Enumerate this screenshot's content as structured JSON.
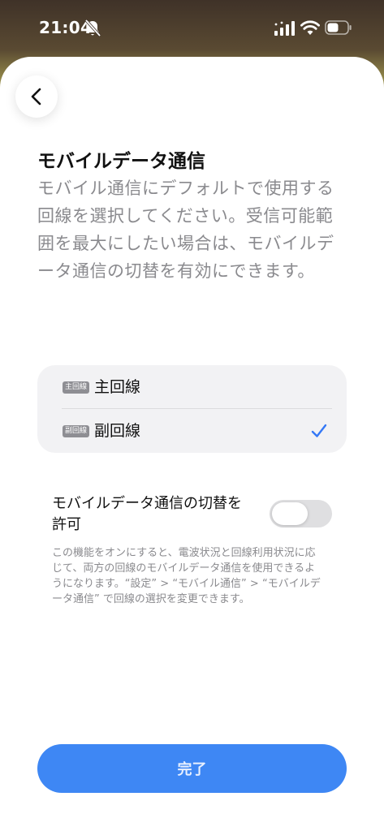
{
  "status_bar": {
    "time": "21:04",
    "icons": [
      "mute-bell-icon",
      "cellular-signal-icon",
      "wifi-icon",
      "battery-icon"
    ]
  },
  "header": {
    "back_icon": "chevron-left-icon",
    "title": "モバイルデータ通信",
    "description": "モバイル通信にデフォルトで使用する回線を選択してください。受信可能範囲を最大にしたい場合は、モバイルデータ通信の切替を有効にできます。"
  },
  "lines": {
    "options": [
      {
        "badge": "主回線",
        "label": "主回線",
        "selected": false
      },
      {
        "badge": "副回線",
        "label": "副回線",
        "selected": true
      }
    ]
  },
  "switching": {
    "label": "モバイルデータ通信の切替を許可",
    "enabled": false,
    "note": "この機能をオンにすると、電波状況と回線利用状況に応じて、両方の回線のモバイルデータ通信を使用できるようになります。“設定” > “モバイル通信” > “モバイルデータ通信” で回線の選択を変更できます。"
  },
  "footer": {
    "done_label": "完了"
  },
  "colors": {
    "accent": "#3e87f4",
    "check": "#3478f6",
    "secondary_text": "#8a8a8e",
    "card_background": "#f2f2f4"
  }
}
